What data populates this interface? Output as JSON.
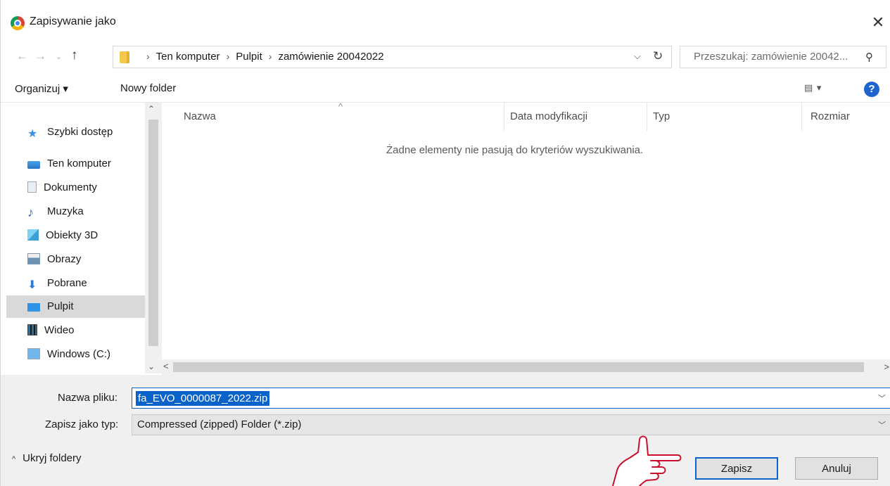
{
  "window": {
    "title": "Zapisywanie jako",
    "close_glyph": "✕"
  },
  "address": {
    "crumbs": [
      "Ten komputer",
      "Pulpit",
      "zamówienie 20042022"
    ],
    "separator": "›",
    "search_placeholder": "Przeszukaj: zamówienie 20042..."
  },
  "toolbar": {
    "organize_label": "Organizuj ▾",
    "new_folder_label": "Nowy folder",
    "view_glyph": "▤ ▾",
    "help_glyph": "?"
  },
  "sidebar": {
    "items": [
      {
        "label": "Szybki dostęp",
        "icon": "star-icon"
      },
      {
        "label": "Ten komputer",
        "icon": "computer-icon"
      },
      {
        "label": "Dokumenty",
        "icon": "documents-icon"
      },
      {
        "label": "Muzyka",
        "icon": "music-icon"
      },
      {
        "label": "Obiekty 3D",
        "icon": "objects-3d-icon"
      },
      {
        "label": "Obrazy",
        "icon": "pictures-icon"
      },
      {
        "label": "Pobrane",
        "icon": "downloads-icon"
      },
      {
        "label": "Pulpit",
        "icon": "desktop-icon",
        "selected": true
      },
      {
        "label": "Wideo",
        "icon": "video-icon"
      },
      {
        "label": "Windows (C:)",
        "icon": "drive-icon"
      }
    ]
  },
  "list": {
    "columns": [
      "Nazwa",
      "Data modyfikacji",
      "Typ",
      "Rozmiar"
    ],
    "empty_message": "Żadne elementy nie pasują do kryteriów wyszukiwania."
  },
  "form": {
    "filename_label": "Nazwa pliku:",
    "filename_value": "fa_EVO_0000087_2022.zip",
    "filetype_label": "Zapisz jako typ:",
    "filetype_value": "Compressed (zipped) Folder (*.zip)"
  },
  "footer": {
    "hide_folders_label": "Ukryj foldery",
    "save_label": "Zapisz",
    "cancel_label": "Anuluj"
  },
  "colors": {
    "accent": "#0a63c9",
    "selection": "#d9d9d9",
    "annotation": "#c8102e"
  }
}
